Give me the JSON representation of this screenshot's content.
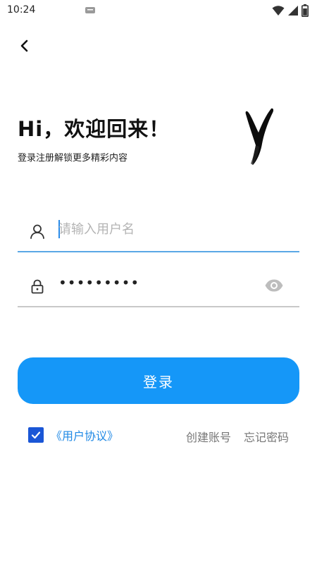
{
  "status_bar": {
    "time": "10:24",
    "icons": [
      "notification-icon",
      "wifi-icon",
      "signal-icon",
      "battery-icon"
    ]
  },
  "header": {
    "back_icon": "chevron-left-icon",
    "greeting": "Hi，欢迎回来！",
    "subtitle": "登录注册解锁更多精彩内容",
    "logo": "brush-y-logo"
  },
  "form": {
    "username": {
      "placeholder": "请输入用户名",
      "value": "",
      "icon": "user-icon"
    },
    "password": {
      "value": "•••••••••",
      "icon": "lock-icon",
      "toggle_icon": "eye-icon"
    },
    "login_label": "登录"
  },
  "footer": {
    "agreement_checked": true,
    "agreement_label": "《用户协议》",
    "create_account_label": "创建账号",
    "forgot_password_label": "忘记密码"
  },
  "colors": {
    "primary": "#1597f8",
    "link": "#1e88e5",
    "checkbox": "#1a56d6",
    "active_underline": "#5aa8e6",
    "inactive_underline": "#c8c8c8",
    "muted_text": "#777777"
  }
}
